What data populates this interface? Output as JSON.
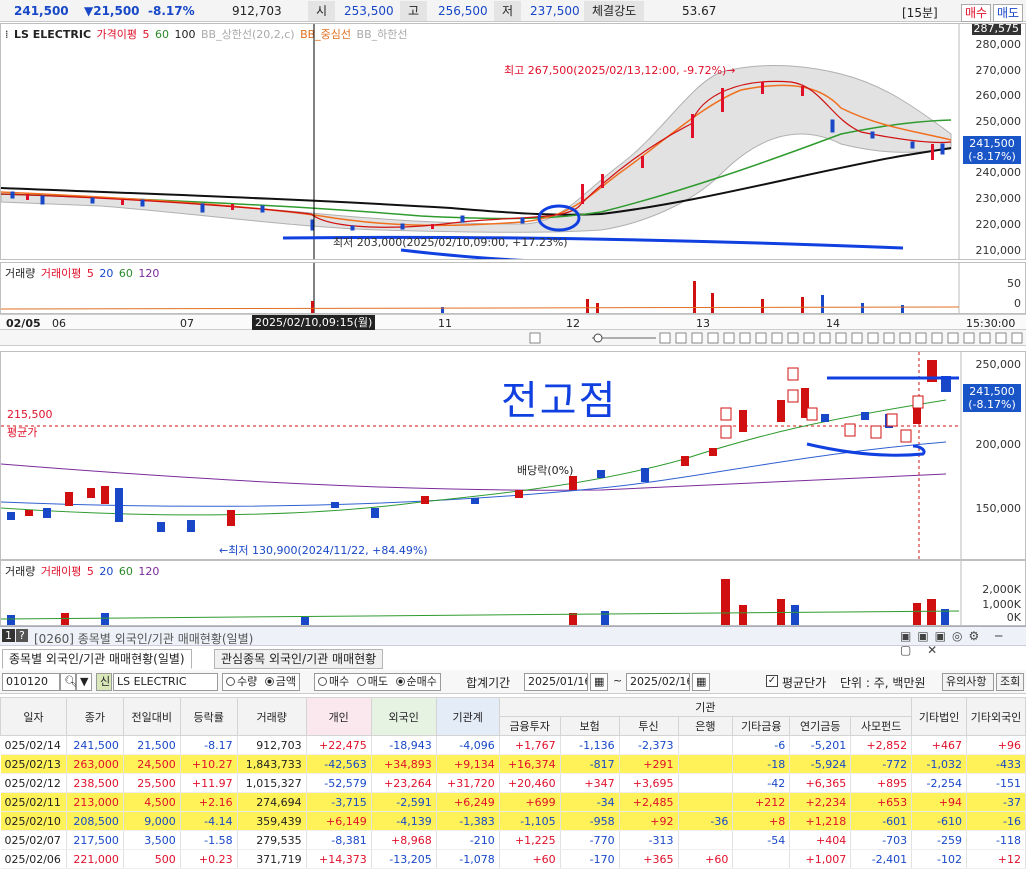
{
  "quote": {
    "price": "241,500",
    "change": "▼21,500",
    "change_pct": "-8.17%",
    "volume": "912,703",
    "open_label": "시",
    "open": "253,500",
    "high_label": "고",
    "high": "256,500",
    "low_label": "저",
    "low": "237,500",
    "strength_label": "체결강도",
    "strength": "53.67",
    "interval": "[15분]",
    "buy_label": "매수",
    "sell_label": "매도"
  },
  "chart1": {
    "name": "LS ELECTRIC",
    "legend": [
      "가격이평",
      "5",
      "60",
      "100",
      "BB_상한선(20,2,c)",
      "BB_중심선",
      "BB_하한선"
    ],
    "y_ticks": [
      "280,000",
      "270,000",
      "260,000",
      "250,000",
      "240,000",
      "230,000",
      "220,000",
      "210,000",
      "200,000"
    ],
    "top_value": "287,575",
    "price_tag": [
      "241,500",
      "(-8.17%)"
    ],
    "high_annotation": "최고 267,500(2025/02/13,12:00, -9.72%)→",
    "low_annotation": "최저 203,000(2025/02/10,09:00, +17.23%)"
  },
  "volume1": {
    "legend": [
      "거래량",
      "거래이평",
      "5",
      "20",
      "60",
      "120"
    ],
    "y_ticks": [
      "50",
      "0"
    ]
  },
  "datebar1": {
    "labels": [
      "02/05",
      "06",
      "07",
      "11",
      "12",
      "13",
      "14"
    ],
    "cursor": "2025/02/10,09:15(월)",
    "time": "15:30:00"
  },
  "chart2": {
    "avg_value": "215,500",
    "avg_label": "평균가",
    "dividend": "배당락(0%)",
    "low_annotation": "←최저 130,900(2024/11/22, +84.49%)",
    "handwriting": "전고점",
    "y_ticks": [
      "250,000",
      "200,000",
      "150,000"
    ],
    "price_tag": [
      "241,500",
      "(-8.17%)"
    ]
  },
  "volume2": {
    "legend": [
      "거래량",
      "거래이평",
      "5",
      "20",
      "60",
      "120"
    ],
    "y_ticks": [
      "2,000K",
      "1,000K",
      "0K"
    ]
  },
  "window": {
    "num": "1",
    "code_title": "[0260] 종목별 외국인/기관 매매현황(일별)"
  },
  "tabs": [
    "종목별 외국인/기관 매매현황(일별)",
    "관심종목 외국인/기관 매매현황"
  ],
  "filters": {
    "code": "010120",
    "name": "LS ELECTRIC",
    "sin": "신",
    "qty": "수량",
    "amount": "금액",
    "buy": "매수",
    "sell": "매도",
    "net": "순매수",
    "period_label": "합계기간",
    "from": "2025/01/16",
    "to": "2025/02/16",
    "avg_price": "평균단가",
    "unit": "단위 : 주, 백만원",
    "notice": "유의사항",
    "query": "조회"
  },
  "table": {
    "headers": [
      "일자",
      "종가",
      "전일대비",
      "등락률",
      "거래량",
      "개인",
      "외국인",
      "기관계",
      "금융투자",
      "보험",
      "투신",
      "은행",
      "기타금융",
      "연기금등",
      "사모펀드",
      "기타법인",
      "기타외국인"
    ],
    "group_header": "기관",
    "rows": [
      [
        "025/02/14",
        "241,500",
        "21,500",
        "-8.17",
        "912,703",
        "+22,475",
        "-18,943",
        "-4,096",
        "+1,767",
        "-1,136",
        "-2,373",
        "",
        "-6",
        "-5,201",
        "+2,852",
        "+467",
        "+96"
      ],
      [
        "025/02/13",
        "263,000",
        "24,500",
        "+10.27",
        "1,843,733",
        "-42,563",
        "+34,893",
        "+9,134",
        "+16,374",
        "-817",
        "+291",
        "",
        "-18",
        "-5,924",
        "-772",
        "-1,032",
        "-433"
      ],
      [
        "025/02/12",
        "238,500",
        "25,500",
        "+11.97",
        "1,015,327",
        "-52,579",
        "+23,264",
        "+31,720",
        "+20,460",
        "+347",
        "+3,695",
        "",
        "-42",
        "+6,365",
        "+895",
        "-2,254",
        "-151"
      ],
      [
        "025/02/11",
        "213,000",
        "4,500",
        "+2.16",
        "274,694",
        "-3,715",
        "-2,591",
        "+6,249",
        "+699",
        "-34",
        "+2,485",
        "",
        "+212",
        "+2,234",
        "+653",
        "+94",
        "-37"
      ],
      [
        "025/02/10",
        "208,500",
        "9,000",
        "-4.14",
        "359,439",
        "+6,149",
        "-4,139",
        "-1,383",
        "-1,105",
        "-958",
        "+92",
        "-36",
        "+8",
        "+1,218",
        "-601",
        "-610",
        "-16"
      ],
      [
        "025/02/07",
        "217,500",
        "3,500",
        "-1.58",
        "279,535",
        "-8,381",
        "+8,968",
        "-210",
        "+1,225",
        "-770",
        "-313",
        "",
        "-54",
        "+404",
        "-703",
        "-259",
        "-118"
      ],
      [
        "025/02/06",
        "221,000",
        "500",
        "+0.23",
        "371,719",
        "+14,373",
        "-13,205",
        "-1,078",
        "+60",
        "-170",
        "+365",
        "+60",
        "",
        "+1,007",
        "-2,401",
        "-102",
        "+12"
      ]
    ]
  }
}
